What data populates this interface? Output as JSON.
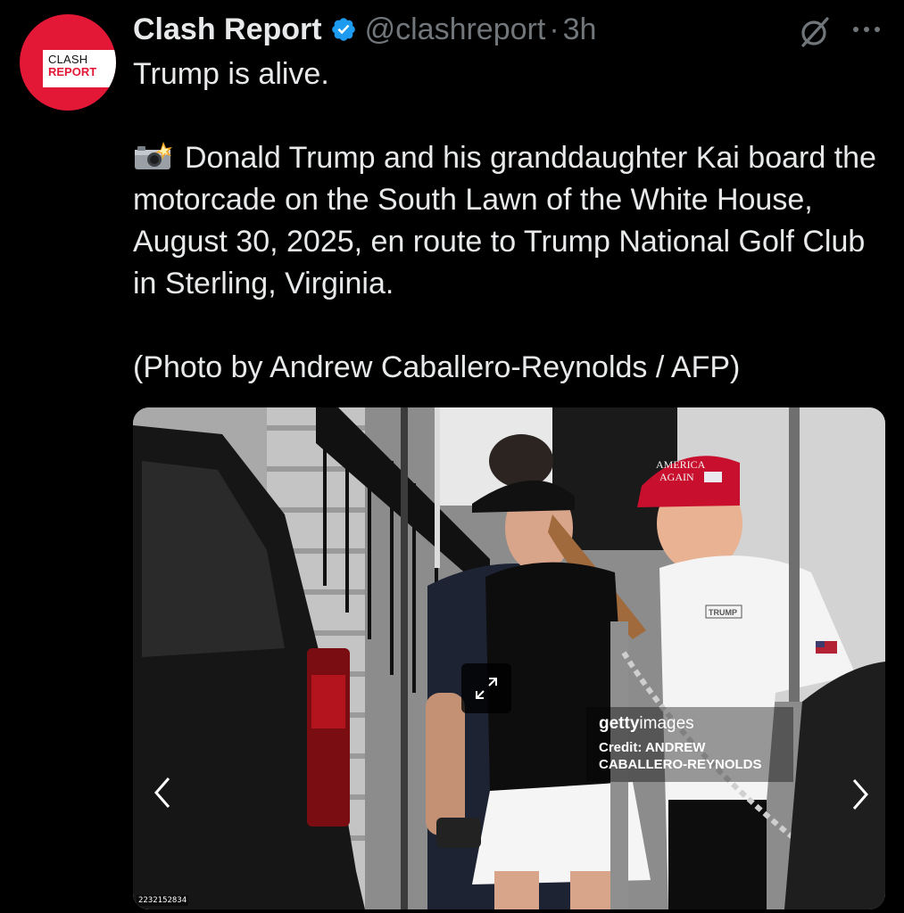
{
  "author": {
    "display_name": "Clash Report",
    "handle": "@clashreport",
    "separator": "·",
    "time": "3h",
    "verified": true,
    "avatar": {
      "line1": "CLASH",
      "line2": "REPORT",
      "background": "#e31837"
    }
  },
  "tweet": {
    "headline": "Trump is alive.",
    "emoji": "camera-with-flash",
    "caption": "Donald Trump and his granddaughter Kai board the motorcade on the South Lawn of the White House, August 30, 2025, en route to Trump National Golf Club in Sterling, Virginia.",
    "photo_credit": "(Photo by Andrew Caballero-Reynolds / AFP)"
  },
  "media": {
    "watermark_brand_bold": "getty",
    "watermark_brand_light": "images",
    "watermark_credit": "Credit: ANDREW CABALLERO-REYNOLDS",
    "image_id": "2232152834",
    "cap_text_line1": "AMERICA",
    "cap_text_line2": "AGAIN",
    "shirt_logo": "TRUMP"
  },
  "colors": {
    "background": "#000000",
    "primary_text": "#e7e9ea",
    "secondary_text": "#71767b",
    "verified_blue": "#1d9bf0",
    "brand_red": "#e31837"
  },
  "icons": [
    "verified-badge-icon",
    "grok-icon",
    "more-icon",
    "camera-flash-icon",
    "expand-icon",
    "chevron-left-icon",
    "chevron-right-icon"
  ]
}
